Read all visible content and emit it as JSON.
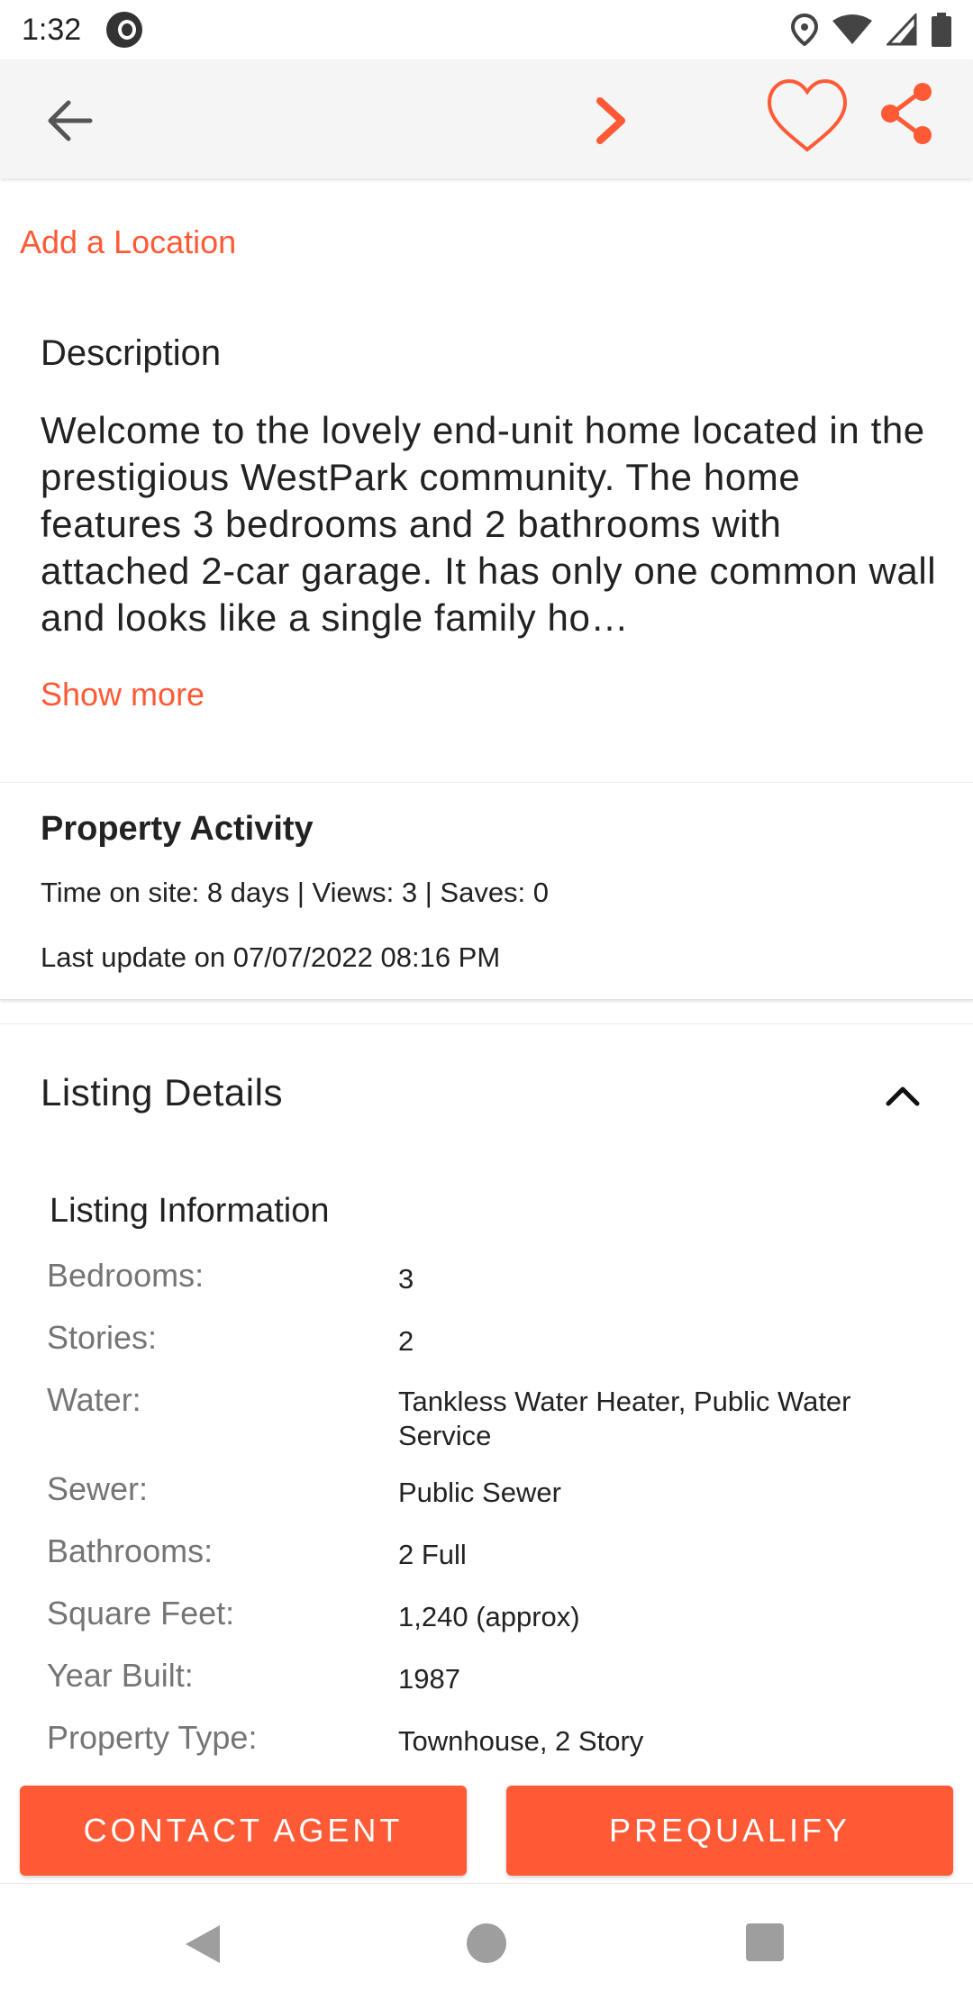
{
  "status_bar": {
    "time": "1:32",
    "icons": [
      "location-icon",
      "wifi-icon",
      "signal-icon",
      "battery-icon"
    ]
  },
  "toolbar": {
    "icons": [
      "back-arrow-icon",
      "next-chevron-icon",
      "heart-outline-icon",
      "share-icon"
    ]
  },
  "add_location": "Add a Location",
  "description": {
    "heading": "Description",
    "body": "Welcome to the lovely end-unit home located in the prestigious WestPark community. The home features 3 bedrooms and 2 bathrooms with attached 2-car garage. It has only one common wall and looks like a single family ho…",
    "show_more": "Show more"
  },
  "activity": {
    "title": "Property Activity",
    "stats": "Time on site: 8 days | Views: 3  | Saves: 0",
    "last_update": "Last update on 07/07/2022 08:16 PM"
  },
  "listing_details": {
    "title": "Listing Details",
    "section_heading": "Listing Information",
    "rows": [
      {
        "label": "Bedrooms:",
        "value": "3"
      },
      {
        "label": "Stories:",
        "value": "2"
      },
      {
        "label": "Water:",
        "value": "Tankless Water Heater, Public Water Service"
      },
      {
        "label": "Sewer:",
        "value": "Public Sewer"
      },
      {
        "label": "Bathrooms:",
        "value": "2 Full"
      },
      {
        "label": "Square Feet:",
        "value": "1,240 (approx)"
      },
      {
        "label": "Year Built:",
        "value": "1987"
      },
      {
        "label": "Property Type:",
        "value": "Townhouse, 2 Story"
      }
    ]
  },
  "actions": {
    "contact_agent": "CONTACT AGENT",
    "prequalify": "PREQUALIFY"
  },
  "colors": {
    "accent": "#ff5a36",
    "toolbar_bg": "#f5f5f5",
    "label_gray": "#757575"
  }
}
